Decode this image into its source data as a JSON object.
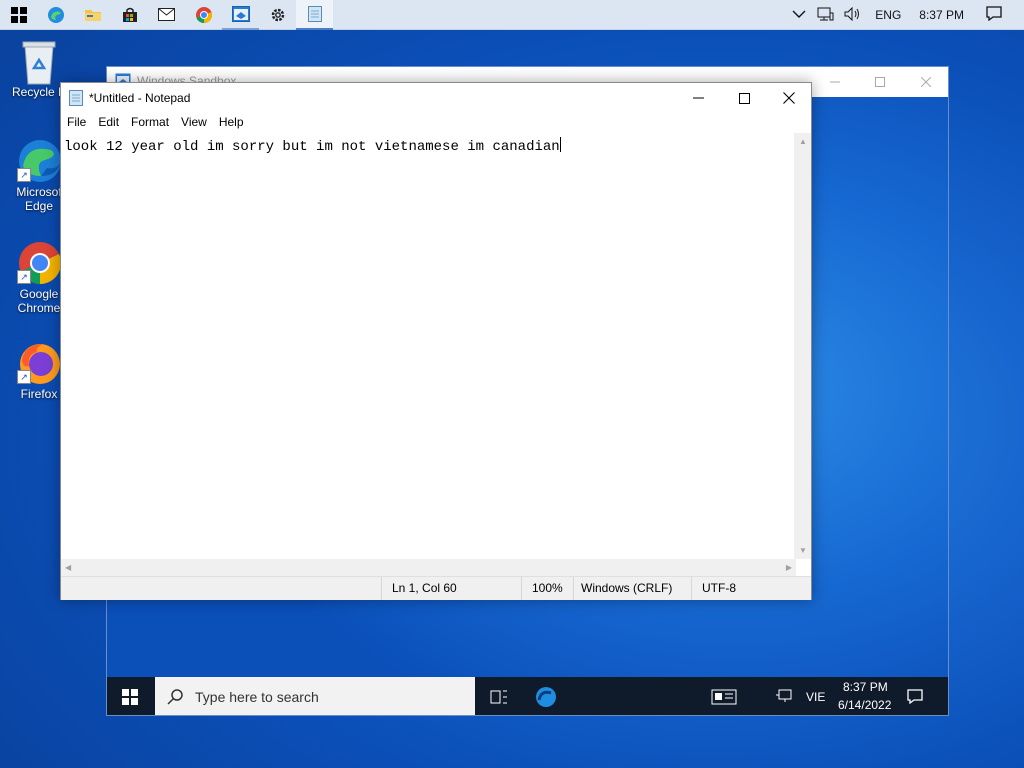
{
  "host_taskbar": {
    "apps": [
      {
        "name": "start",
        "icon": "windows-logo-icon"
      },
      {
        "name": "edge",
        "icon": "edge-icon"
      },
      {
        "name": "file-explorer",
        "icon": "folder-icon"
      },
      {
        "name": "store",
        "icon": "store-bag-icon"
      },
      {
        "name": "mail",
        "icon": "mail-icon"
      },
      {
        "name": "chrome",
        "icon": "chrome-icon"
      },
      {
        "name": "sandbox",
        "icon": "sandbox-icon"
      },
      {
        "name": "settings",
        "icon": "gear-icon"
      },
      {
        "name": "notepad",
        "icon": "notepad-icon"
      }
    ],
    "tray": {
      "language": "ENG",
      "time": "8:37 PM"
    }
  },
  "desktop_icons": [
    {
      "label_line1": "Recycle B",
      "label_line2": "",
      "icon": "recycle-bin-icon"
    },
    {
      "label_line1": "Microsof",
      "label_line2": "Edge",
      "icon": "edge-icon"
    },
    {
      "label_line1": "Google",
      "label_line2": "Chrome",
      "icon": "chrome-icon"
    },
    {
      "label_line1": "Firefox",
      "label_line2": "",
      "icon": "firefox-icon"
    }
  ],
  "sandbox_window": {
    "title": "Windows Sandbox",
    "taskbar": {
      "search_placeholder": "Type here to search",
      "language": "VIE",
      "time": "8:37 PM",
      "date": "6/14/2022"
    }
  },
  "notepad": {
    "title": "*Untitled - Notepad",
    "menu": [
      "File",
      "Edit",
      "Format",
      "View",
      "Help"
    ],
    "content": "look 12 year old im sorry but im not vietnamese im canadian",
    "status": {
      "position": "Ln 1, Col 60",
      "zoom": "100%",
      "line_ending": "Windows (CRLF)",
      "encoding": "UTF-8"
    }
  }
}
